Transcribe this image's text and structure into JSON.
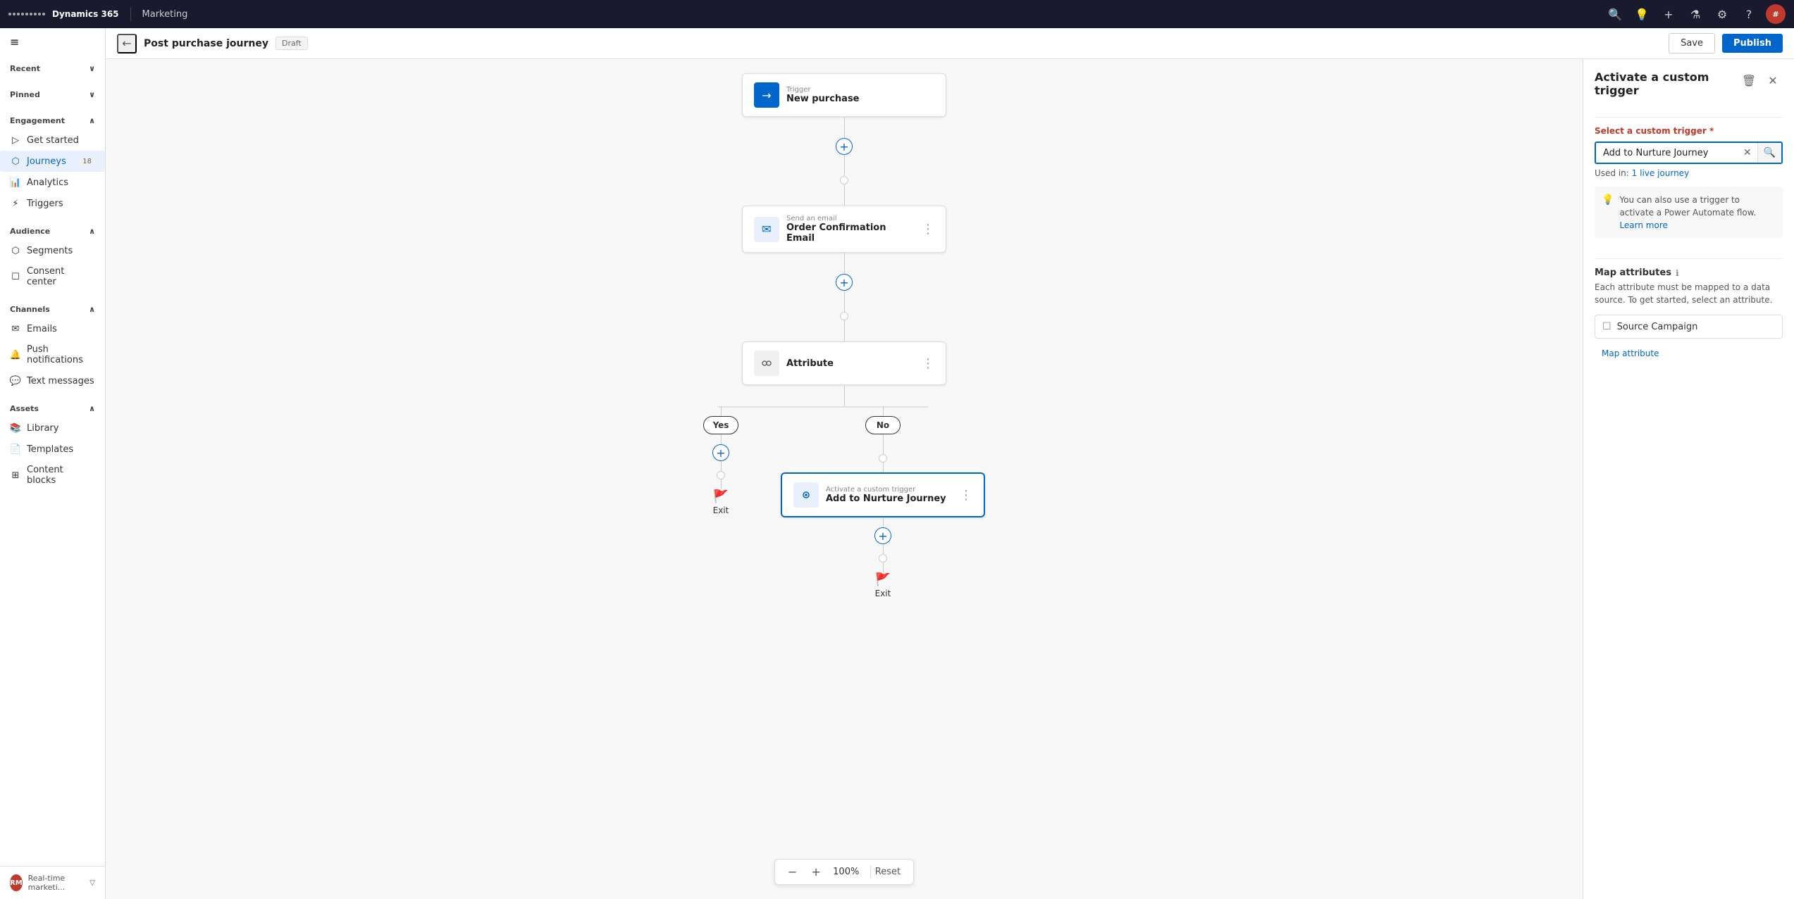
{
  "topbar": {
    "app_name": "Dynamics 365",
    "module_name": "Marketing",
    "avatar_initials": "#"
  },
  "secondary_bar": {
    "back_label": "←",
    "page_title": "Post purchase journey",
    "status": "Draft",
    "save_label": "Save",
    "publish_label": "Publish"
  },
  "sidebar": {
    "hamburger": "≡",
    "recent_label": "Recent",
    "pinned_label": "Pinned",
    "engagement_label": "Engagement",
    "items_engagement": [
      {
        "label": "Get started",
        "icon": "▷"
      },
      {
        "label": "Journeys",
        "icon": "⬡",
        "count": "18"
      },
      {
        "label": "Analytics",
        "icon": "📊"
      },
      {
        "label": "Triggers",
        "icon": "⚡"
      }
    ],
    "audience_label": "Audience",
    "items_audience": [
      {
        "label": "Segments",
        "icon": "⬡"
      },
      {
        "label": "Consent center",
        "icon": "☐"
      }
    ],
    "channels_label": "Channels",
    "items_channels": [
      {
        "label": "Emails",
        "icon": "✉"
      },
      {
        "label": "Push notifications",
        "icon": "🔔"
      },
      {
        "label": "Text messages",
        "icon": "💬"
      }
    ],
    "assets_label": "Assets",
    "items_assets": [
      {
        "label": "Library",
        "icon": "📚"
      },
      {
        "label": "Templates",
        "icon": "📄"
      },
      {
        "label": "Content blocks",
        "icon": "⊞"
      }
    ],
    "bottom_label": "Real-time marketi...",
    "bottom_avatar": "RM"
  },
  "canvas": {
    "trigger_label": "Trigger",
    "trigger_title": "New purchase",
    "email_label": "Send an email",
    "email_title": "Order Confirmation Email",
    "attribute_label": "Attribute",
    "yes_label": "Yes",
    "no_label": "No",
    "exit_label": "Exit",
    "custom_trigger_label": "Activate a custom trigger",
    "custom_trigger_title": "Add to Nurture Journey",
    "zoom_minus": "−",
    "zoom_pct": "100%",
    "zoom_plus": "+",
    "zoom_reset": "Reset"
  },
  "right_panel": {
    "title": "Activate a custom trigger",
    "delete_icon": "🗑",
    "close_icon": "✕",
    "select_label": "Select a custom trigger",
    "required_marker": "*",
    "search_value": "Add to Nurture Journey",
    "used_in_text": "Used in: ",
    "used_in_link": "1 live journey",
    "info_text": "You can also use a trigger to activate a Power Automate flow.",
    "learn_more_label": "Learn more",
    "map_attributes_label": "Map attributes",
    "map_desc": "Each attribute must be mapped to a data source. To get started, select an attribute.",
    "attr_icon": "☐",
    "attr_title": "Source Campaign",
    "map_attr_link": "Map attribute"
  }
}
